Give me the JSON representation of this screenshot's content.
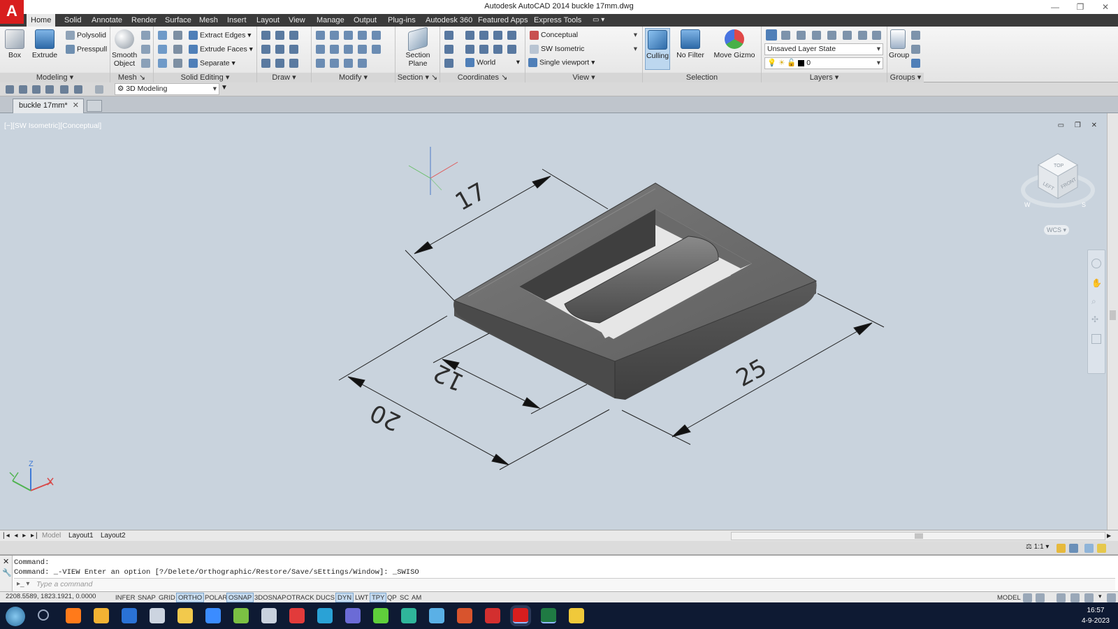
{
  "window": {
    "app_logo": "A",
    "title": "Autodesk AutoCAD 2014    buckle 17mm.dwg",
    "minimize": "—",
    "maximize": "❐",
    "close": "✕"
  },
  "menu_tabs": [
    "Home",
    "Solid",
    "Annotate",
    "Render",
    "Surface",
    "Mesh",
    "Insert",
    "Layout",
    "View",
    "Manage",
    "Output",
    "Plug-ins",
    "Autodesk 360",
    "Featured Apps",
    "Express Tools"
  ],
  "ribbon": {
    "panels": {
      "modeling": "Modeling",
      "mesh": "Mesh",
      "solid_editing": "Solid Editing",
      "draw": "Draw",
      "modify": "Modify",
      "section": "Section",
      "coordinates": "Coordinates",
      "view": "View",
      "selection": "Selection",
      "layers": "Layers",
      "groups": "Groups"
    },
    "box": "Box",
    "extrude": "Extrude",
    "polysolid": "Polysolid",
    "presspull": "Presspull",
    "smooth_object": "Smooth Object",
    "extract_edges": "Extract Edges",
    "extrude_faces": "Extrude Faces",
    "separate": "Separate",
    "section_plane": "Section Plane",
    "world": "World",
    "visual_style": "Conceptual",
    "view_name": "SW Isometric",
    "viewport": "Single viewport",
    "culling": "Culling",
    "no_filter": "No Filter",
    "move_gizmo": "Move Gizmo",
    "layer_state": "Unsaved Layer State",
    "current_layer": "0",
    "group": "Group"
  },
  "quick_access": {
    "workspace": "3D Modeling"
  },
  "document": {
    "tab_label": "buckle 17mm*",
    "tab_close": "✕"
  },
  "viewport": {
    "label": "[−][SW Isometric][Conceptual]",
    "controls": "▭ ❐ ✕",
    "viewcube": {
      "top": "TOP",
      "left": "LEFT",
      "front": "FRONT",
      "compass_w": "W",
      "compass_s": "S"
    },
    "wcs": "WCS",
    "ucs_z": "Z",
    "dimensions": {
      "top_width": "17",
      "inner_width": "12",
      "outer_width": "20",
      "length": "25"
    }
  },
  "layout_tabs": [
    "Model",
    "Layout1",
    "Layout2"
  ],
  "annotation": {
    "scale": "1:1"
  },
  "command": {
    "history": [
      "Command:",
      "Command: _-VIEW Enter an option [?/Delete/Orthographic/Restore/Save/sEttings/Window]: _SWISO"
    ],
    "placeholder": "Type a command"
  },
  "status": {
    "coords": "2208.5589, 1823.1921, 0.0000",
    "toggles": [
      {
        "label": "INFER",
        "on": false
      },
      {
        "label": "SNAP",
        "on": false
      },
      {
        "label": "GRID",
        "on": false
      },
      {
        "label": "ORTHO",
        "on": true
      },
      {
        "label": "POLAR",
        "on": false
      },
      {
        "label": "OSNAP",
        "on": true
      },
      {
        "label": "3DOSNAP",
        "on": false
      },
      {
        "label": "OTRACK",
        "on": false
      },
      {
        "label": "DUCS",
        "on": false
      },
      {
        "label": "DYN",
        "on": true
      },
      {
        "label": "LWT",
        "on": false
      },
      {
        "label": "TPY",
        "on": true
      },
      {
        "label": "QP",
        "on": false
      },
      {
        "label": "SC",
        "on": false
      },
      {
        "label": "AM",
        "on": false
      }
    ],
    "model": "MODEL"
  },
  "taskbar": {
    "icons": [
      "search-icon",
      "firefox-icon",
      "layers-app-icon",
      "outlook-icon",
      "settings-icon",
      "file-explorer-icon",
      "bluetooth-icon",
      "android-icon",
      "mixer-icon",
      "record-icon",
      "c-app-icon",
      "globe-app-icon",
      "u-app-icon",
      "d-app-icon",
      "cube-app-icon",
      "books-app-icon",
      "pdf-app-icon",
      "autocad-icon",
      "excel-icon",
      "tool-app-icon"
    ],
    "icon_colors": [
      "#9aa8c0",
      "#ff7a1a",
      "#f2b233",
      "#2a72d6",
      "#ccd4e0",
      "#f2c94c",
      "#3b8cff",
      "#7bc043",
      "#c9d1de",
      "#e23b3b",
      "#2aa2d6",
      "#6b6bd6",
      "#5fcf3b",
      "#2fb59a",
      "#5ab0e6",
      "#d8542d",
      "#d32f2f",
      "#d81e1e",
      "#1f7a43",
      "#f0c93a"
    ],
    "time": "16:57",
    "date": "4-9-2023"
  },
  "colors": {
    "accent_toggle": "#c6dcf1",
    "viewport_bg": "#c9d3dd",
    "menubar": "#3b3b3b",
    "autocad_red": "#d81e1e"
  }
}
